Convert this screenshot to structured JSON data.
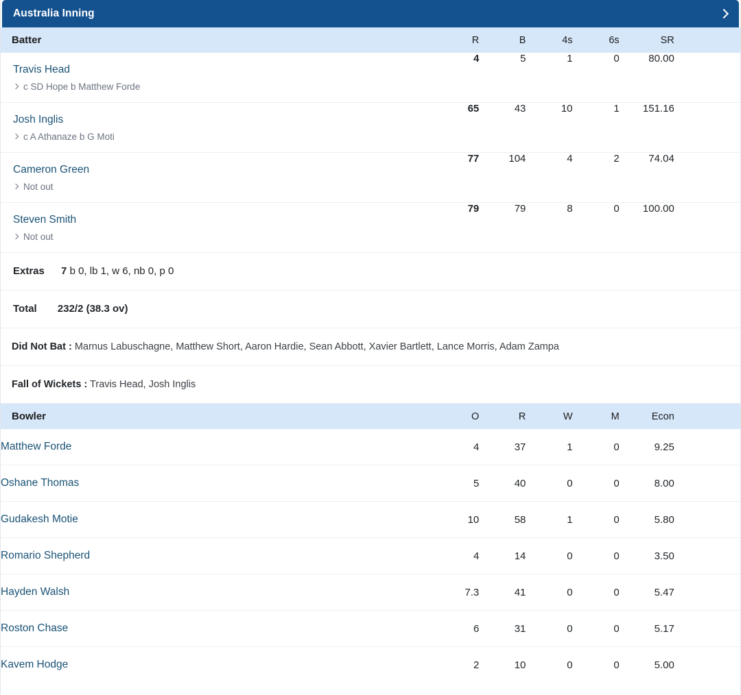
{
  "inning": {
    "title": "Australia Inning",
    "expand_icon": "chevron-right-icon"
  },
  "batting": {
    "headers": {
      "name": "Batter",
      "r": "R",
      "b": "B",
      "fours": "4s",
      "sixes": "6s",
      "sr": "SR"
    },
    "rows": [
      {
        "name": "Travis Head",
        "dismissal": "c SD Hope b Matthew Forde",
        "r": "4",
        "b": "5",
        "fours": "1",
        "sixes": "0",
        "sr": "80.00"
      },
      {
        "name": "Josh Inglis",
        "dismissal": "c A Athanaze b G Moti",
        "r": "65",
        "b": "43",
        "fours": "10",
        "sixes": "1",
        "sr": "151.16"
      },
      {
        "name": "Cameron Green",
        "dismissal": "Not out",
        "r": "77",
        "b": "104",
        "fours": "4",
        "sixes": "2",
        "sr": "74.04"
      },
      {
        "name": "Steven Smith",
        "dismissal": "Not out",
        "r": "79",
        "b": "79",
        "fours": "8",
        "sixes": "0",
        "sr": "100.00"
      }
    ]
  },
  "extras": {
    "label": "Extras",
    "value": "7",
    "breakdown": "b 0, lb 1, w 6, nb 0, p 0"
  },
  "total": {
    "label": "Total",
    "value": "232/2 (38.3 ov)"
  },
  "did_not_bat": {
    "label": "Did Not Bat :",
    "players": "Marnus Labuschagne, Matthew Short, Aaron Hardie, Sean Abbott, Xavier Bartlett, Lance Morris, Adam Zampa"
  },
  "fall_of_wickets": {
    "label": "Fall of Wickets :",
    "players": "Travis Head, Josh Inglis"
  },
  "bowling": {
    "headers": {
      "name": "Bowler",
      "o": "O",
      "r": "R",
      "w": "W",
      "m": "M",
      "econ": "Econ"
    },
    "rows": [
      {
        "name": "Matthew Forde",
        "o": "4",
        "r": "37",
        "w": "1",
        "m": "0",
        "econ": "9.25"
      },
      {
        "name": "Oshane Thomas",
        "o": "5",
        "r": "40",
        "w": "0",
        "m": "0",
        "econ": "8.00"
      },
      {
        "name": "Gudakesh Motie",
        "o": "10",
        "r": "58",
        "w": "1",
        "m": "0",
        "econ": "5.80"
      },
      {
        "name": "Romario Shepherd",
        "o": "4",
        "r": "14",
        "w": "0",
        "m": "0",
        "econ": "3.50"
      },
      {
        "name": "Hayden Walsh",
        "o": "7.3",
        "r": "41",
        "w": "0",
        "m": "0",
        "econ": "5.47"
      },
      {
        "name": "Roston Chase",
        "o": "6",
        "r": "31",
        "w": "0",
        "m": "0",
        "econ": "5.17"
      },
      {
        "name": "Kavem Hodge",
        "o": "2",
        "r": "10",
        "w": "0",
        "m": "0",
        "econ": "5.00"
      }
    ]
  },
  "colors": {
    "header_blue": "#14528f",
    "table_header_blue": "#d6e7fa",
    "link": "#1a5276",
    "muted": "#6b7280",
    "divider": "#eceef0"
  }
}
